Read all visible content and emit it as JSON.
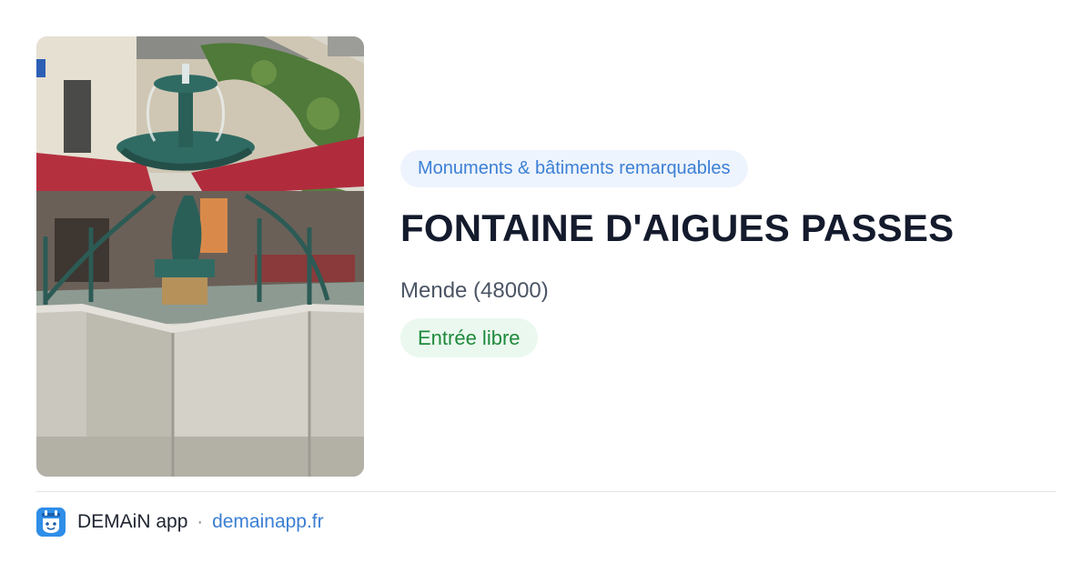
{
  "card": {
    "image_alt": "Fontaine",
    "category": "Monuments & bâtiments remarquables",
    "title": "FONTAINE D'AIGUES PASSES",
    "location": "Mende (48000)",
    "entry": "Entrée libre"
  },
  "footer": {
    "logo_icon": "calendar-face-icon",
    "app_name": "DEMAiN app",
    "separator": "·",
    "link": "demainapp.fr"
  },
  "colors": {
    "category_text": "#3b7fd4",
    "category_bg": "#eef4fd",
    "entry_text": "#1f8a3c",
    "entry_bg": "#ebf8ef",
    "title": "#141b2d",
    "logo_bg": "#2f8ee8"
  }
}
